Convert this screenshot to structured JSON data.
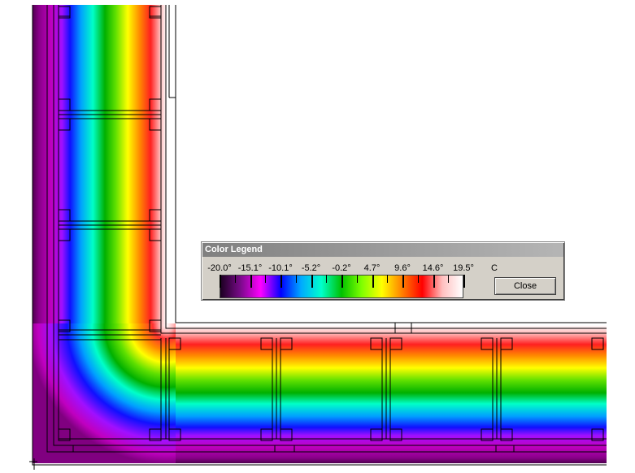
{
  "legend": {
    "title": "Color Legend",
    "tick_labels": [
      "-20.0°",
      "-15.1°",
      "-10.1°",
      "-5.2°",
      "-0.2°",
      "4.7°",
      "9.6°",
      "14.6°",
      "19.5°"
    ],
    "unit": "C",
    "close_label": "Close",
    "gradient_colors": [
      "#1a0020",
      "#7a0a8a",
      "#ff00ff",
      "#0000ff",
      "#00aaff",
      "#00ffcc",
      "#00c000",
      "#7fff00",
      "#ffff00",
      "#ff8000",
      "#ff0000",
      "#ffc0c0",
      "#ffffff"
    ]
  },
  "colors": {
    "window_face": "#d4d0c8",
    "titlebar_start": "#808080",
    "frame_lines": "#000000"
  }
}
